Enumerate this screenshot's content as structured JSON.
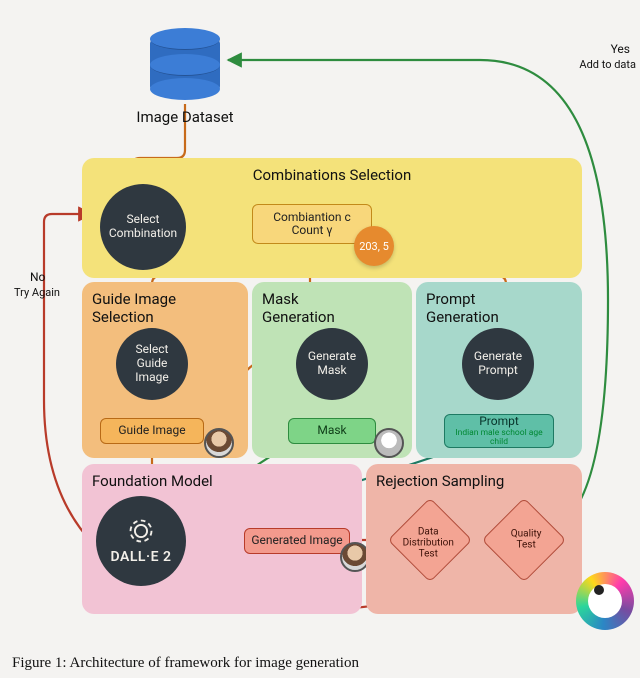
{
  "dataset": {
    "label": "Image Dataset"
  },
  "modules": {
    "combinations": {
      "title": "Combinations Selection",
      "node": "Select\nCombination",
      "output": "Combiantion c\nCount γ",
      "count_bubble": "203, 5"
    },
    "guide": {
      "title": "Guide Image\nSelection",
      "node": "Select\nGuide\nImage",
      "output": "Guide Image"
    },
    "mask": {
      "title": "Mask\nGeneration",
      "node": "Generate\nMask",
      "output": "Mask"
    },
    "prompt": {
      "title": "Prompt\nGeneration",
      "node": "Generate\nPrompt",
      "output": "Prompt",
      "example": "Indian male school age child"
    },
    "foundation": {
      "title": "Foundation Model",
      "node": "DALL·E 2",
      "output": "Generated Image"
    },
    "rejection": {
      "title": "Rejection Sampling",
      "test1": "Data\nDistribution\nTest",
      "test2": "Quality\nTest"
    }
  },
  "edges": {
    "yes": "Yes",
    "yes_sub": "Add to data",
    "no": "No",
    "no_sub": "Try Again"
  },
  "caption": "Figure 1: Architecture of framework for image generation"
}
